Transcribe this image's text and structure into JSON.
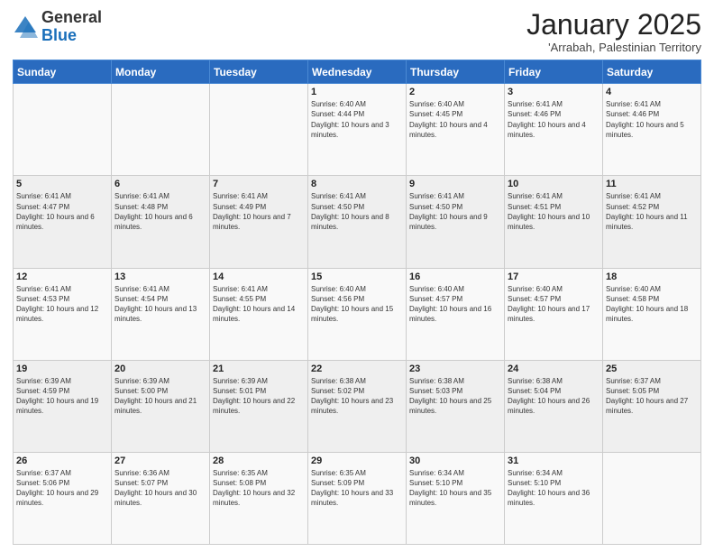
{
  "logo": {
    "general": "General",
    "blue": "Blue"
  },
  "header": {
    "title": "January 2025",
    "subtitle": "'Arrabah, Palestinian Territory"
  },
  "weekdays": [
    "Sunday",
    "Monday",
    "Tuesday",
    "Wednesday",
    "Thursday",
    "Friday",
    "Saturday"
  ],
  "weeks": [
    [
      {
        "day": "",
        "info": ""
      },
      {
        "day": "",
        "info": ""
      },
      {
        "day": "",
        "info": ""
      },
      {
        "day": "1",
        "info": "Sunrise: 6:40 AM\nSunset: 4:44 PM\nDaylight: 10 hours and 3 minutes."
      },
      {
        "day": "2",
        "info": "Sunrise: 6:40 AM\nSunset: 4:45 PM\nDaylight: 10 hours and 4 minutes."
      },
      {
        "day": "3",
        "info": "Sunrise: 6:41 AM\nSunset: 4:46 PM\nDaylight: 10 hours and 4 minutes."
      },
      {
        "day": "4",
        "info": "Sunrise: 6:41 AM\nSunset: 4:46 PM\nDaylight: 10 hours and 5 minutes."
      }
    ],
    [
      {
        "day": "5",
        "info": "Sunrise: 6:41 AM\nSunset: 4:47 PM\nDaylight: 10 hours and 6 minutes."
      },
      {
        "day": "6",
        "info": "Sunrise: 6:41 AM\nSunset: 4:48 PM\nDaylight: 10 hours and 6 minutes."
      },
      {
        "day": "7",
        "info": "Sunrise: 6:41 AM\nSunset: 4:49 PM\nDaylight: 10 hours and 7 minutes."
      },
      {
        "day": "8",
        "info": "Sunrise: 6:41 AM\nSunset: 4:50 PM\nDaylight: 10 hours and 8 minutes."
      },
      {
        "day": "9",
        "info": "Sunrise: 6:41 AM\nSunset: 4:50 PM\nDaylight: 10 hours and 9 minutes."
      },
      {
        "day": "10",
        "info": "Sunrise: 6:41 AM\nSunset: 4:51 PM\nDaylight: 10 hours and 10 minutes."
      },
      {
        "day": "11",
        "info": "Sunrise: 6:41 AM\nSunset: 4:52 PM\nDaylight: 10 hours and 11 minutes."
      }
    ],
    [
      {
        "day": "12",
        "info": "Sunrise: 6:41 AM\nSunset: 4:53 PM\nDaylight: 10 hours and 12 minutes."
      },
      {
        "day": "13",
        "info": "Sunrise: 6:41 AM\nSunset: 4:54 PM\nDaylight: 10 hours and 13 minutes."
      },
      {
        "day": "14",
        "info": "Sunrise: 6:41 AM\nSunset: 4:55 PM\nDaylight: 10 hours and 14 minutes."
      },
      {
        "day": "15",
        "info": "Sunrise: 6:40 AM\nSunset: 4:56 PM\nDaylight: 10 hours and 15 minutes."
      },
      {
        "day": "16",
        "info": "Sunrise: 6:40 AM\nSunset: 4:57 PM\nDaylight: 10 hours and 16 minutes."
      },
      {
        "day": "17",
        "info": "Sunrise: 6:40 AM\nSunset: 4:57 PM\nDaylight: 10 hours and 17 minutes."
      },
      {
        "day": "18",
        "info": "Sunrise: 6:40 AM\nSunset: 4:58 PM\nDaylight: 10 hours and 18 minutes."
      }
    ],
    [
      {
        "day": "19",
        "info": "Sunrise: 6:39 AM\nSunset: 4:59 PM\nDaylight: 10 hours and 19 minutes."
      },
      {
        "day": "20",
        "info": "Sunrise: 6:39 AM\nSunset: 5:00 PM\nDaylight: 10 hours and 21 minutes."
      },
      {
        "day": "21",
        "info": "Sunrise: 6:39 AM\nSunset: 5:01 PM\nDaylight: 10 hours and 22 minutes."
      },
      {
        "day": "22",
        "info": "Sunrise: 6:38 AM\nSunset: 5:02 PM\nDaylight: 10 hours and 23 minutes."
      },
      {
        "day": "23",
        "info": "Sunrise: 6:38 AM\nSunset: 5:03 PM\nDaylight: 10 hours and 25 minutes."
      },
      {
        "day": "24",
        "info": "Sunrise: 6:38 AM\nSunset: 5:04 PM\nDaylight: 10 hours and 26 minutes."
      },
      {
        "day": "25",
        "info": "Sunrise: 6:37 AM\nSunset: 5:05 PM\nDaylight: 10 hours and 27 minutes."
      }
    ],
    [
      {
        "day": "26",
        "info": "Sunrise: 6:37 AM\nSunset: 5:06 PM\nDaylight: 10 hours and 29 minutes."
      },
      {
        "day": "27",
        "info": "Sunrise: 6:36 AM\nSunset: 5:07 PM\nDaylight: 10 hours and 30 minutes."
      },
      {
        "day": "28",
        "info": "Sunrise: 6:35 AM\nSunset: 5:08 PM\nDaylight: 10 hours and 32 minutes."
      },
      {
        "day": "29",
        "info": "Sunrise: 6:35 AM\nSunset: 5:09 PM\nDaylight: 10 hours and 33 minutes."
      },
      {
        "day": "30",
        "info": "Sunrise: 6:34 AM\nSunset: 5:10 PM\nDaylight: 10 hours and 35 minutes."
      },
      {
        "day": "31",
        "info": "Sunrise: 6:34 AM\nSunset: 5:10 PM\nDaylight: 10 hours and 36 minutes."
      },
      {
        "day": "",
        "info": ""
      }
    ]
  ]
}
